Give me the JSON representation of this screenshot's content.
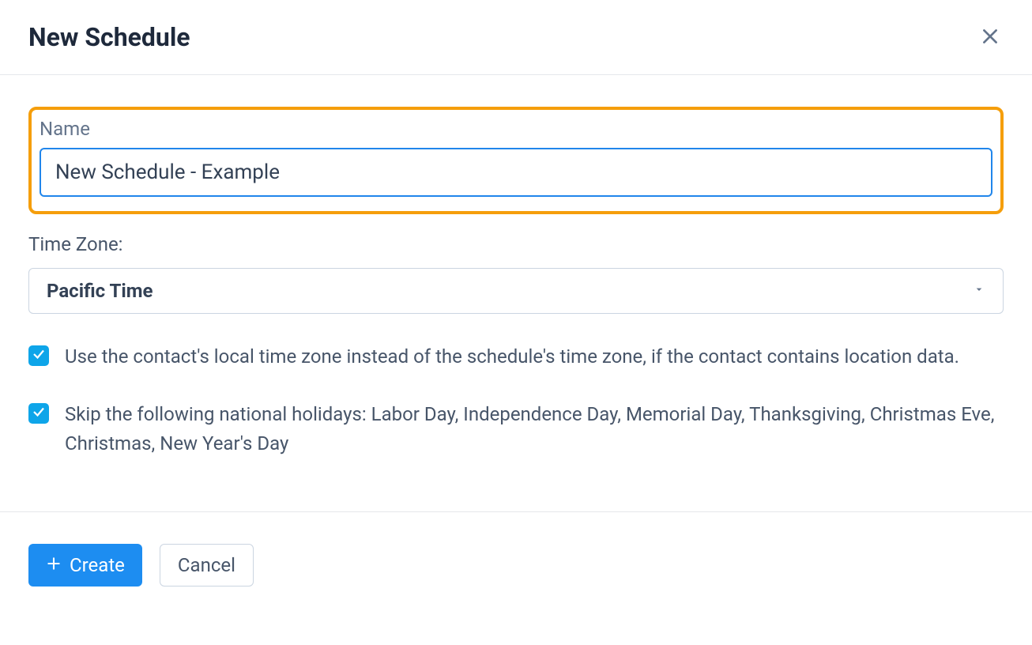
{
  "modal": {
    "title": "New Schedule"
  },
  "form": {
    "name_label": "Name",
    "name_value": "New Schedule - Example",
    "timezone_label": "Time Zone:",
    "timezone_value": "Pacific Time",
    "checkbox_local_tz": {
      "checked": true,
      "label": "Use the contact's local time zone instead of the schedule's time zone, if the contact contains location data."
    },
    "checkbox_holidays": {
      "checked": true,
      "label": "Skip the following national holidays: Labor Day, Independence Day, Memorial Day, Thanksgiving, Christmas Eve, Christmas, New Year's Day"
    }
  },
  "footer": {
    "create_label": "Create",
    "cancel_label": "Cancel"
  }
}
